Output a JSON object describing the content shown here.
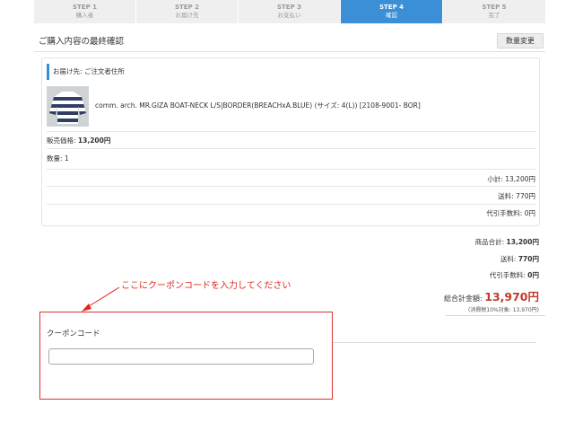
{
  "steps": [
    {
      "title": "STEP 1",
      "sub": "購入者"
    },
    {
      "title": "STEP 2",
      "sub": "お届け先"
    },
    {
      "title": "STEP 3",
      "sub": "お支払い"
    },
    {
      "title": "STEP 4",
      "sub": "確認"
    },
    {
      "title": "STEP 5",
      "sub": "完了"
    }
  ],
  "colors": {
    "accent": "#3a8fd6",
    "price_red": "#c0392b",
    "annotation_red": "#e0281e"
  },
  "section": {
    "title": "ご購入内容の最終確認",
    "qty_change_button": "数量変更"
  },
  "order": {
    "address_label": "お届け先: ご注文者住所",
    "product_name": "comm. arch. MR.GIZA BOAT-NECK L/S|BORDER(BREACHxA.BLUE) (サイズ: 4(L)) [2108-9001- BOR]",
    "price_label": "販売価格: ",
    "price_value": "13,200円",
    "quantity_text": "数量: 1",
    "subtotal": "小計: 13,200円",
    "shipping": "送料: 770円",
    "cod_fee": "代引手数料: 0円"
  },
  "totals": {
    "goods_label": "商品合計: ",
    "goods_value": "13,200円",
    "shipping_label": "送料: ",
    "shipping_value": "770円",
    "cod_label": "代引手数料: ",
    "cod_value": "0円",
    "grand_label": "総合計金額: ",
    "grand_value": "13,970円",
    "tax_note": "(消費税10%対象: 13,970円)"
  },
  "annotation": {
    "text": "ここにクーポンコードを入力してください"
  },
  "coupon": {
    "label": "クーポンコード",
    "value": ""
  }
}
